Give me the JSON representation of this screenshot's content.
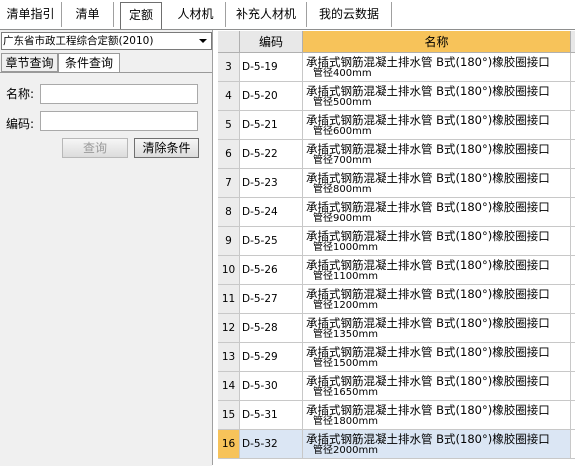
{
  "top_tabs": [
    {
      "label": "清单指引"
    },
    {
      "label": "清单"
    },
    {
      "label": "定额"
    },
    {
      "label": "人材机"
    },
    {
      "label": "补充人材机"
    },
    {
      "label": "我的云数据"
    }
  ],
  "left": {
    "library_select": "广东省市政工程综合定额(2010)",
    "tabs": [
      "章节查询",
      "条件查询"
    ],
    "active_tab": "条件查询",
    "name_label": "名称:",
    "name_value": "",
    "code_label": "编码:",
    "code_value": "",
    "query_button": "查询",
    "clear_button": "清除条件"
  },
  "grid": {
    "headers": {
      "code": "编码",
      "name": "名称"
    },
    "selected_row": 16,
    "rows": [
      {
        "idx": "3",
        "code": "D-5-19",
        "name1": "承插式钢筋混凝土排水管 B式(180°)橡胶圈接口",
        "name2": "管径400mm"
      },
      {
        "idx": "4",
        "code": "D-5-20",
        "name1": "承插式钢筋混凝土排水管 B式(180°)橡胶圈接口",
        "name2": "管径500mm"
      },
      {
        "idx": "5",
        "code": "D-5-21",
        "name1": "承插式钢筋混凝土排水管 B式(180°)橡胶圈接口",
        "name2": "管径600mm"
      },
      {
        "idx": "6",
        "code": "D-5-22",
        "name1": "承插式钢筋混凝土排水管 B式(180°)橡胶圈接口",
        "name2": "管径700mm"
      },
      {
        "idx": "7",
        "code": "D-5-23",
        "name1": "承插式钢筋混凝土排水管 B式(180°)橡胶圈接口",
        "name2": "管径800mm"
      },
      {
        "idx": "8",
        "code": "D-5-24",
        "name1": "承插式钢筋混凝土排水管 B式(180°)橡胶圈接口",
        "name2": "管径900mm"
      },
      {
        "idx": "9",
        "code": "D-5-25",
        "name1": "承插式钢筋混凝土排水管 B式(180°)橡胶圈接口",
        "name2": "管径1000mm"
      },
      {
        "idx": "10",
        "code": "D-5-26",
        "name1": "承插式钢筋混凝土排水管 B式(180°)橡胶圈接口",
        "name2": "管径1100mm"
      },
      {
        "idx": "11",
        "code": "D-5-27",
        "name1": "承插式钢筋混凝土排水管 B式(180°)橡胶圈接口",
        "name2": "管径1200mm"
      },
      {
        "idx": "12",
        "code": "D-5-28",
        "name1": "承插式钢筋混凝土排水管 B式(180°)橡胶圈接口",
        "name2": "管径1350mm"
      },
      {
        "idx": "13",
        "code": "D-5-29",
        "name1": "承插式钢筋混凝土排水管 B式(180°)橡胶圈接口",
        "name2": "管径1500mm"
      },
      {
        "idx": "14",
        "code": "D-5-30",
        "name1": "承插式钢筋混凝土排水管 B式(180°)橡胶圈接口",
        "name2": "管径1650mm"
      },
      {
        "idx": "15",
        "code": "D-5-31",
        "name1": "承插式钢筋混凝土排水管 B式(180°)橡胶圈接口",
        "name2": "管径1800mm"
      },
      {
        "idx": "16",
        "code": "D-5-32",
        "name1": "承插式钢筋混凝土排水管 B式(180°)橡胶圈接口",
        "name2": "管径2000mm"
      }
    ]
  },
  "colors": {
    "header_highlight": "#f7c35a",
    "selected_row": "#dbe6f4"
  }
}
